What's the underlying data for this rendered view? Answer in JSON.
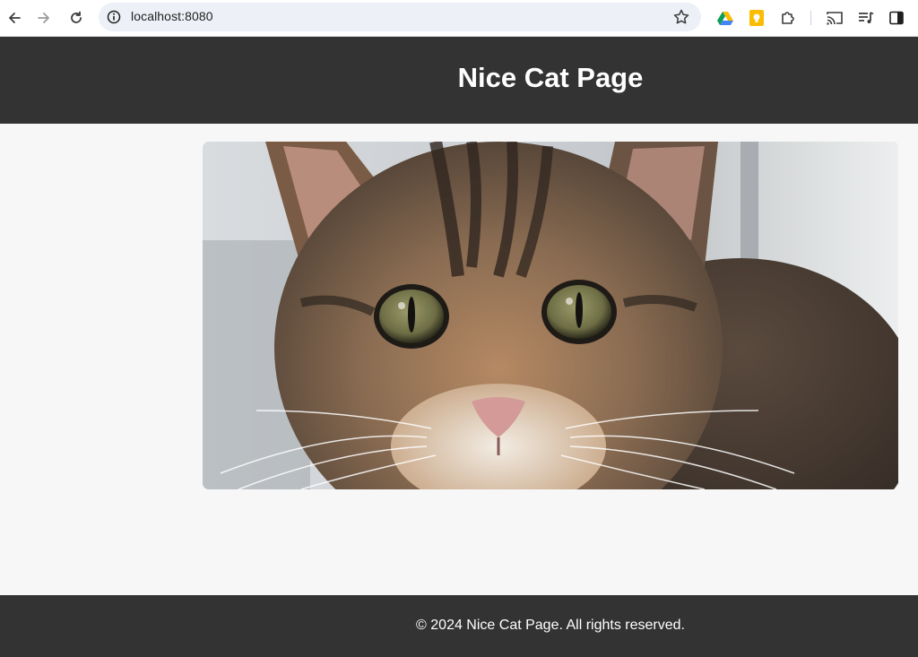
{
  "browser": {
    "url": "localhost:8080",
    "icons": {
      "back": "arrow-left-icon",
      "forward": "arrow-right-icon",
      "reload": "reload-icon",
      "site_info": "info-icon",
      "bookmark": "star-icon",
      "drive": "google-drive-icon",
      "keep": "google-keep-icon",
      "extensions": "puzzle-icon",
      "cast": "cast-icon",
      "media": "media-controls-icon",
      "side_panel": "side-panel-icon"
    }
  },
  "page": {
    "title": "Nice Cat Page",
    "image_alt": "cat-photo",
    "footer": "© 2024 Nice Cat Page. All rights reserved."
  },
  "colors": {
    "header_bg": "#333333",
    "footer_bg": "#333333",
    "page_bg": "#f7f7f7",
    "header_text": "#ffffff"
  }
}
